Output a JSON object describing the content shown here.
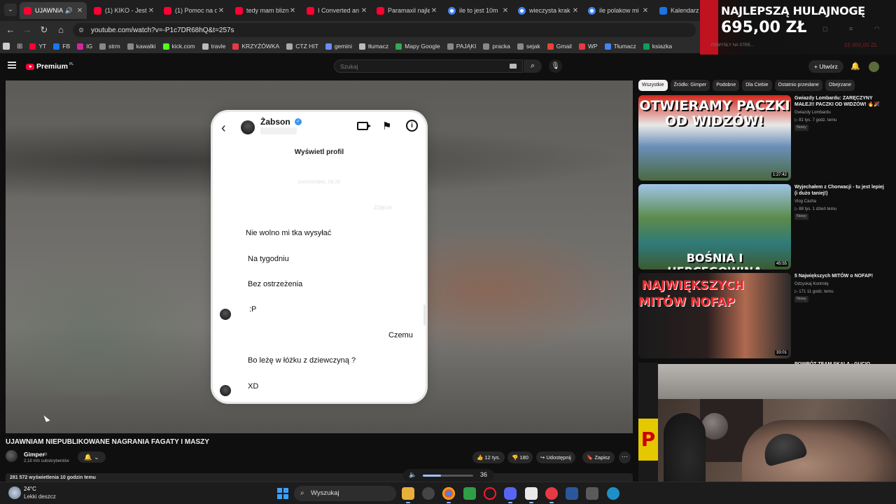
{
  "browser": {
    "tabs": [
      {
        "title": "UJAWNIA",
        "icon": "youtube-icon",
        "active": true
      },
      {
        "title": "(1) KIKO - Jeste",
        "icon": "youtube-icon"
      },
      {
        "title": "(1) Pomoc na d",
        "icon": "youtube-icon"
      },
      {
        "title": "tedy mam blizn",
        "icon": "youtube-icon"
      },
      {
        "title": "I Converted an",
        "icon": "youtube-icon"
      },
      {
        "title": "Paramaxil najle",
        "icon": "youtube-icon"
      },
      {
        "title": "ile to jest 10m",
        "icon": "google-icon"
      },
      {
        "title": "wieczysta krak",
        "icon": "google-icon"
      },
      {
        "title": "ile polakow mi",
        "icon": "google-icon"
      },
      {
        "title": "Kalendarz Go",
        "icon": "calendar-icon"
      }
    ],
    "url": "youtube.com/watch?v=-P1c7DR68hQ&t=257s",
    "bookmarks": [
      {
        "label": "YT",
        "color": "#ff0033"
      },
      {
        "label": "FB",
        "color": "#1877f2"
      },
      {
        "label": "IG",
        "color": "#d6249f"
      },
      {
        "label": "strm",
        "color": "#888888"
      },
      {
        "label": "kawalki",
        "color": "#888888"
      },
      {
        "label": "kick.com",
        "color": "#53fc18"
      },
      {
        "label": "travle",
        "color": "#bbbbbb"
      },
      {
        "label": "KRZYŻÓWKA",
        "color": "#e63946"
      },
      {
        "label": "CTZ HIT",
        "color": "#aaaaaa"
      },
      {
        "label": "gemini",
        "color": "#6b8cff"
      },
      {
        "label": "tłumacz",
        "color": "#bbbbbb"
      },
      {
        "label": "Mapy Google",
        "color": "#34a853"
      },
      {
        "label": "PAJĄKI",
        "color": "#888888"
      },
      {
        "label": "pracka",
        "color": "#888888"
      },
      {
        "label": "sejak",
        "color": "#888888"
      },
      {
        "label": "Gmail",
        "color": "#ea4335"
      },
      {
        "label": "WP",
        "color": "#e63946"
      },
      {
        "label": "Tłumacz",
        "color": "#4285f4"
      },
      {
        "label": "ksiazka",
        "color": "#0f9d58"
      }
    ]
  },
  "youtube": {
    "logo": "Premium",
    "logo_suffix": "PL",
    "search_placeholder": "Szukaj",
    "create_label": "+ Utwórz",
    "video": {
      "title": "UJAWNIAM NIEPUBLIKOWANE NAGRANIA FAGATY I MASZY",
      "channel": "Gimper",
      "subscribers": "2,18 mln subskrybentów",
      "likes": "12 tys.",
      "dislikes": "180",
      "share": "Udostępnij",
      "save": "Zapisz",
      "views_line": "281 572 wyświetlenia  10 godzin temu"
    },
    "chat": {
      "contact": "Żabson",
      "view_profile": "Wyświetl profil",
      "timestamp_blur": "poniedziałek, 08:26",
      "seen_blur": "Zdjęcie",
      "messages": [
        "Nie wolno mi tka wysyłać",
        "Na tygodniu",
        "Bez ostrzeżenia",
        ":P",
        "Czemu",
        "Bo leżę w łóżku z dziewczyną ?",
        "XD"
      ]
    },
    "chips": [
      "Wszystkie",
      "Źródło: Gimper",
      "Podobne",
      "Dla Ciebie",
      "Ostatnio przesłane",
      "Obejrzane"
    ],
    "recommendations": [
      {
        "title": "Gwiazdy Lombardu: ZARĘCZYNY MAŁEJ!! PACZKI OD WIDZÓW! 🔥🎉",
        "channel": "Gwiazdy Lombardu",
        "meta": "▷ 81 tys.  7 godz. temu",
        "badge": "Nowy",
        "duration": "1:27:42",
        "thumb_text": "OTWIERAMY PACZKI OD WIDZÓW!"
      },
      {
        "title": "Wyjechałem z Chorwacji - tu jest lepiej (i dużo taniej!)",
        "channel": "Vlog Casha",
        "meta": "▷ 88 tys.  1 dzień temu",
        "badge": "Nowy",
        "duration": "45:55",
        "thumb_text": "BOŚNIA I HERCEGOWINA"
      },
      {
        "title": "5 Największych MITÓW o NOFAP!",
        "channel": "Odzyskaj Kontrolę",
        "meta": "▷ 171  11 godz. temu",
        "badge": "Nowy",
        "duration": "33:01",
        "thumb_text": "5 NAJWIĘKSZYCH MITÓW NOFAP"
      }
    ],
    "partial_rec_title": "POWRÓT TEAM SKALA - GUCIO"
  },
  "overlay": {
    "promo_line1": "NAJLEPSZĄ HULAJNOGĘ",
    "promo_price": "695,00 ZŁ",
    "promo_sub": "POMYSŁY NA STRE...",
    "promo_ghost": "15 000,00 ZŁ"
  },
  "volume": {
    "value": "36",
    "level": 0.36
  },
  "taskbar": {
    "temperature": "24°C",
    "condition": "Lekki deszcz",
    "search_label": "Wyszukaj"
  }
}
